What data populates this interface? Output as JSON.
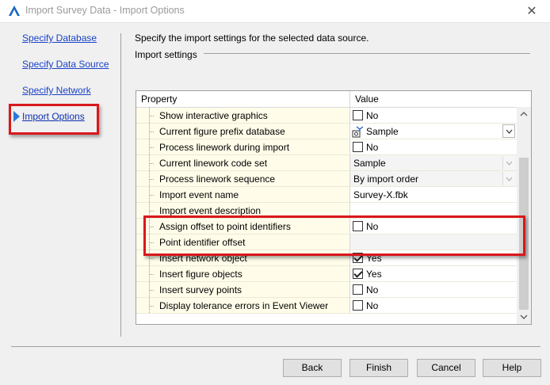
{
  "window": {
    "title": "Import Survey Data - Import Options",
    "close_glyph": "✕",
    "icons": {
      "app": "civil3d-app-icon",
      "close": "close-icon"
    }
  },
  "nav": {
    "items": [
      {
        "label": "Specify Database",
        "selected": false
      },
      {
        "label": "Specify Data Source",
        "selected": false
      },
      {
        "label": "Specify Network",
        "selected": false
      },
      {
        "label": "Import Options",
        "selected": true
      }
    ],
    "selected_indicator_icon": "selected-arrow-icon"
  },
  "main": {
    "instruction": "Specify the import settings for the selected data source.",
    "group_label": "Import settings",
    "grid": {
      "columns": {
        "property": "Property",
        "value": "Value"
      },
      "rows": [
        {
          "property": "Show interactive graphics",
          "type": "checkbox",
          "checked": false,
          "value": "No"
        },
        {
          "property": "Current figure prefix database",
          "type": "combo-icon",
          "icon": "figure-prefix-icon",
          "value": "Sample"
        },
        {
          "property": "Process linework during import",
          "type": "checkbox",
          "checked": false,
          "value": "No"
        },
        {
          "property": "Current linework code set",
          "type": "combo-disabled",
          "value": "Sample"
        },
        {
          "property": "Process linework sequence",
          "type": "combo-disabled",
          "value": "By import order"
        },
        {
          "property": "Import event name",
          "type": "text",
          "value": "Survey-X.fbk"
        },
        {
          "property": "Import event description",
          "type": "text",
          "value": ""
        },
        {
          "property": "Assign offset to point identifiers",
          "type": "checkbox",
          "checked": false,
          "value": "No"
        },
        {
          "property": "Point identifier offset",
          "type": "text-disabled",
          "value": ""
        },
        {
          "property": "Insert network object",
          "type": "checkbox",
          "checked": true,
          "value": "Yes"
        },
        {
          "property": "Insert figure objects",
          "type": "checkbox",
          "checked": true,
          "value": "Yes"
        },
        {
          "property": "Insert survey points",
          "type": "checkbox",
          "checked": false,
          "value": "No"
        },
        {
          "property": "Display tolerance errors in Event Viewer",
          "type": "checkbox",
          "checked": false,
          "value": "No"
        }
      ]
    }
  },
  "buttons": {
    "back": "Back",
    "finish": "Finish",
    "cancel": "Cancel",
    "help": "Help"
  },
  "colors": {
    "link": "#1a43c8",
    "annotation_red": "#d9181b",
    "property_cell_bg": "#fffde9",
    "dialog_bg": "#f0f0f0"
  }
}
